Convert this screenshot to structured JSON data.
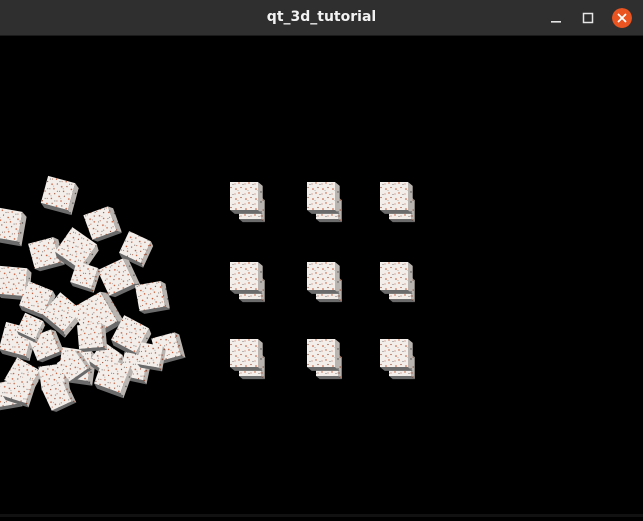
{
  "window": {
    "title": "qt_3d_tutorial",
    "controls": {
      "minimize": "minimize-icon",
      "maximize": "maximize-icon",
      "close": "close-icon"
    },
    "close_color": "#e95420"
  },
  "scene": {
    "background": "#000000",
    "cube_face_color": "#f3eeea",
    "cube_speckle_color": "#c0502a",
    "cube_shadow_color": "#6b6b6b",
    "left_cluster_count": 30,
    "grid_rows": 3,
    "grid_cols": 3
  }
}
